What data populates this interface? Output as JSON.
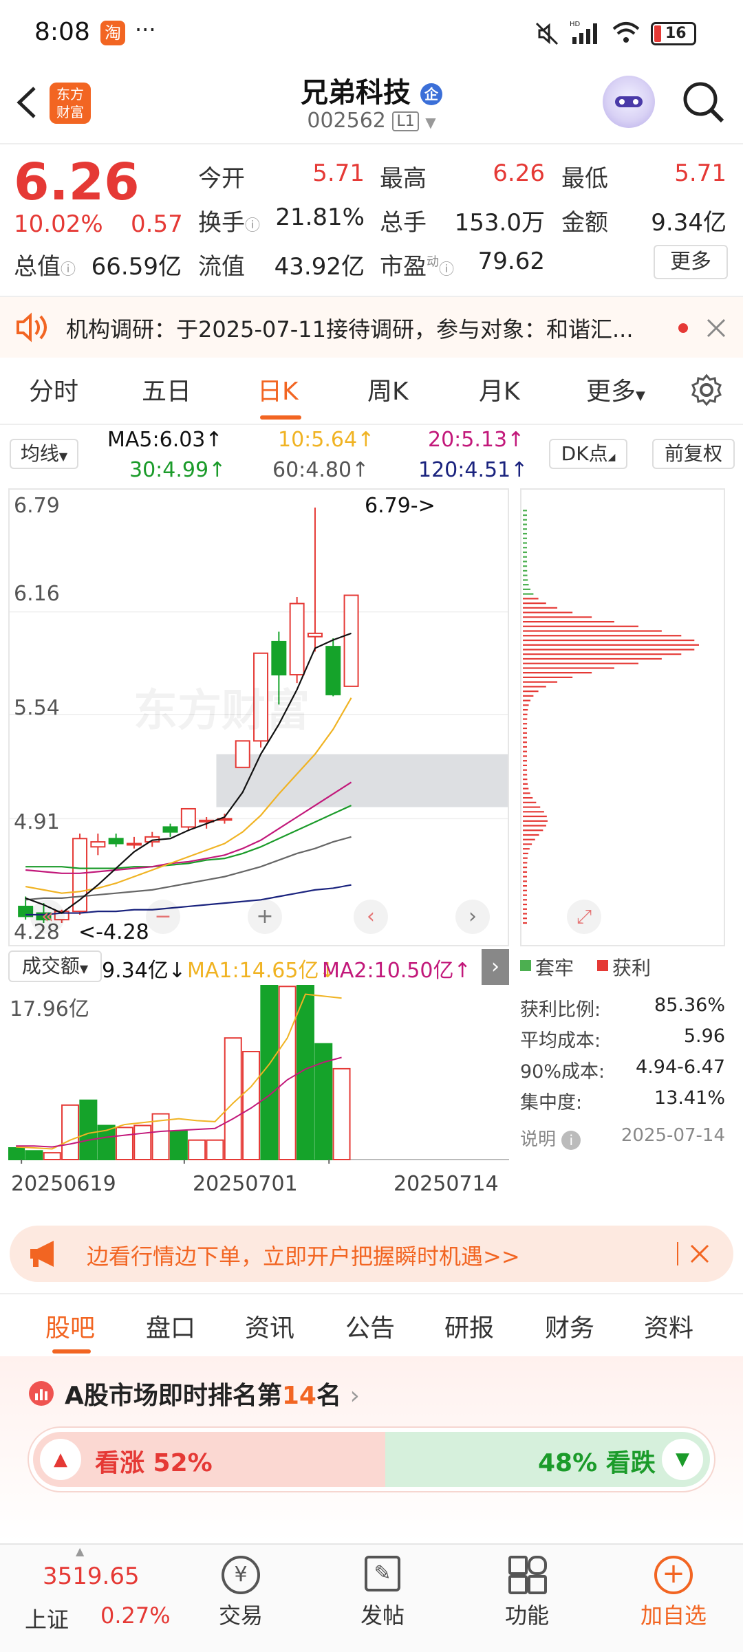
{
  "status": {
    "time": "8:08",
    "app_badge": "淘",
    "more": "···",
    "battery": "16"
  },
  "header": {
    "logo_text": "东方\n财富",
    "title": "兄弟科技",
    "badge": "企",
    "code": "002562",
    "level": "L1"
  },
  "quote": {
    "price": "6.26",
    "pct": "10.02%",
    "change": "0.57",
    "fields": [
      {
        "label": "今开",
        "value": "5.71"
      },
      {
        "label": "最高",
        "value": "6.26"
      },
      {
        "label": "最低",
        "value": "5.71"
      },
      {
        "label": "换手",
        "value": "21.81%"
      },
      {
        "label": "总手",
        "value": "153.0万"
      },
      {
        "label": "金额",
        "value": "9.34亿"
      },
      {
        "label": "总值",
        "value": "66.59亿"
      },
      {
        "label": "流值",
        "value": "43.92亿"
      },
      {
        "label": "市盈",
        "value": "79.62"
      }
    ],
    "pe_sup": "动",
    "more_btn": "更多"
  },
  "notice": {
    "text": "机构调研：于2025-07-11接待调研，参与对象：和谐汇..."
  },
  "period_tabs": {
    "items": [
      "分时",
      "五日",
      "日K",
      "周K",
      "月K",
      "更多"
    ],
    "active": "日K"
  },
  "ma_bar": {
    "selector": "均线",
    "ma5": "MA5:6.03↑",
    "ma10": "10:5.64↑",
    "ma20": "20:5.13↑",
    "ma30": "30:4.99↑",
    "ma60": "60:4.80↑",
    "ma120": "120:4.51↑",
    "dk_btn": "DK点",
    "adjust_btn": "前复权"
  },
  "colors": {
    "up": "#e53935",
    "down": "#15a32a",
    "ma5": "#111111",
    "ma10": "#f0b323",
    "ma20": "#c2187a",
    "ma30": "#1b9b2a",
    "ma60": "#666666",
    "ma120": "#1a237e",
    "brand": "#f26522"
  },
  "chart_data": [
    {
      "type": "candlestick",
      "title": "",
      "y_ticks": [
        "6.79",
        "6.16",
        "5.54",
        "4.91",
        "4.28"
      ],
      "ylim": [
        4.28,
        6.79
      ],
      "annotations": {
        "high": "6.79->",
        "low": "<-4.28"
      },
      "candles": [
        {
          "o": 4.38,
          "h": 4.44,
          "l": 4.3,
          "c": 4.32
        },
        {
          "o": 4.34,
          "h": 4.4,
          "l": 4.28,
          "c": 4.3
        },
        {
          "o": 4.3,
          "h": 4.36,
          "l": 4.28,
          "c": 4.35
        },
        {
          "o": 4.35,
          "h": 4.82,
          "l": 4.33,
          "c": 4.79
        },
        {
          "o": 4.74,
          "h": 4.82,
          "l": 4.69,
          "c": 4.77
        },
        {
          "o": 4.79,
          "h": 4.82,
          "l": 4.74,
          "c": 4.76
        },
        {
          "o": 4.76,
          "h": 4.8,
          "l": 4.73,
          "c": 4.76
        },
        {
          "o": 4.77,
          "h": 4.83,
          "l": 4.74,
          "c": 4.8
        },
        {
          "o": 4.86,
          "h": 4.88,
          "l": 4.8,
          "c": 4.83
        },
        {
          "o": 4.86,
          "h": 4.97,
          "l": 4.84,
          "c": 4.97
        },
        {
          "o": 4.9,
          "h": 4.92,
          "l": 4.85,
          "c": 4.9
        },
        {
          "o": 4.91,
          "h": 4.94,
          "l": 4.88,
          "c": 4.91
        },
        {
          "o": 5.22,
          "h": 5.38,
          "l": 5.22,
          "c": 5.38
        },
        {
          "o": 5.38,
          "h": 5.91,
          "l": 5.34,
          "c": 5.91
        },
        {
          "o": 5.98,
          "h": 6.04,
          "l": 5.6,
          "c": 5.78
        },
        {
          "o": 5.78,
          "h": 6.25,
          "l": 5.73,
          "c": 6.21
        },
        {
          "o": 6.01,
          "h": 6.79,
          "l": 5.92,
          "c": 6.03
        },
        {
          "o": 5.95,
          "h": 6.0,
          "l": 5.65,
          "c": 5.66
        },
        {
          "o": 5.71,
          "h": 6.26,
          "l": 5.71,
          "c": 6.26
        }
      ],
      "ma5": [
        4.43,
        4.39,
        4.34,
        4.42,
        4.51,
        4.61,
        4.71,
        4.78,
        4.79,
        4.84,
        4.88,
        4.92,
        5.07,
        5.3,
        5.48,
        5.69,
        5.94,
        5.99,
        6.03
      ],
      "ma10": [
        4.5,
        4.48,
        4.46,
        4.47,
        4.49,
        4.52,
        4.56,
        4.6,
        4.64,
        4.68,
        4.72,
        4.76,
        4.83,
        4.93,
        5.06,
        5.18,
        5.3,
        5.45,
        5.64
      ],
      "ma20": [
        4.6,
        4.59,
        4.58,
        4.58,
        4.59,
        4.6,
        4.61,
        4.62,
        4.64,
        4.65,
        4.67,
        4.69,
        4.73,
        4.78,
        4.85,
        4.92,
        4.99,
        5.06,
        5.13
      ],
      "ma30": [
        4.62,
        4.62,
        4.62,
        4.61,
        4.61,
        4.61,
        4.62,
        4.62,
        4.63,
        4.64,
        4.66,
        4.67,
        4.7,
        4.74,
        4.79,
        4.84,
        4.89,
        4.94,
        4.99
      ],
      "ma60": [
        4.42,
        4.43,
        4.43,
        4.44,
        4.45,
        4.46,
        4.47,
        4.48,
        4.5,
        4.52,
        4.54,
        4.56,
        4.59,
        4.62,
        4.66,
        4.7,
        4.73,
        4.77,
        4.8
      ],
      "ma120": [
        4.33,
        4.33,
        4.34,
        4.34,
        4.35,
        4.35,
        4.36,
        4.36,
        4.37,
        4.38,
        4.39,
        4.4,
        4.41,
        4.42,
        4.44,
        4.46,
        4.48,
        4.49,
        4.51
      ],
      "x_labels": [
        "20250619",
        "20250701",
        "20250714"
      ]
    },
    {
      "type": "bar",
      "title": "成交额",
      "legend": {
        "value": "9.34亿↓",
        "ma1": "MA1:14.65亿↓",
        "ma2": "MA2:10.50亿↑"
      },
      "y_max_label": "17.96亿",
      "ylim": [
        0,
        17.96
      ],
      "values": [
        1.2,
        0.9,
        0.7,
        5.6,
        6.1,
        3.5,
        3.3,
        3.5,
        4.7,
        2.9,
        2.0,
        2.0,
        12.5,
        11.1,
        17.96,
        17.8,
        17.96,
        11.9,
        9.34
      ],
      "up": [
        false,
        false,
        true,
        true,
        false,
        false,
        true,
        true,
        true,
        false,
        true,
        true,
        true,
        true,
        false,
        true,
        false,
        false,
        true
      ],
      "ma1": [
        1.3,
        1.2,
        1.1,
        2.0,
        2.7,
        3.0,
        3.6,
        3.8,
        4.0,
        4.2,
        4.0,
        3.9,
        5.8,
        7.5,
        9.8,
        12.5,
        17.0,
        16.8,
        16.6
      ],
      "ma2": [
        1.4,
        1.4,
        1.3,
        1.6,
        2.0,
        2.3,
        2.5,
        2.7,
        2.9,
        3.0,
        3.1,
        3.2,
        4.2,
        5.3,
        6.6,
        8.2,
        9.3,
        10.0,
        10.5
      ]
    }
  ],
  "chips": {
    "legend_trapped": "套牢",
    "legend_profit": "获利",
    "stats": [
      {
        "label": "获利比例:",
        "value": "85.36%"
      },
      {
        "label": "平均成本:",
        "value": "5.96"
      },
      {
        "label": "90%成本:",
        "value": "4.94-6.47"
      },
      {
        "label": "集中度:",
        "value": "13.41%"
      }
    ],
    "note_label": "说明",
    "date": "2025-07-14"
  },
  "promo": {
    "text": "边看行情边下单，立即开户把握瞬时机遇>>"
  },
  "bottom_tabs": {
    "items": [
      "股吧",
      "盘口",
      "资讯",
      "公告",
      "研报",
      "财务",
      "资料"
    ],
    "active": "股吧"
  },
  "ranking": {
    "prefix": "A股市场即时排名第",
    "rank": "14",
    "suffix": "名"
  },
  "sentiment": {
    "up_label": "看涨 52%",
    "down_label": "48% 看跌",
    "up_pct": 52
  },
  "bottom_nav": {
    "index_value": "3519.65",
    "index_name": "上证",
    "index_pct": "0.27%",
    "items": [
      "交易",
      "发帖",
      "功能",
      "加自选"
    ]
  }
}
